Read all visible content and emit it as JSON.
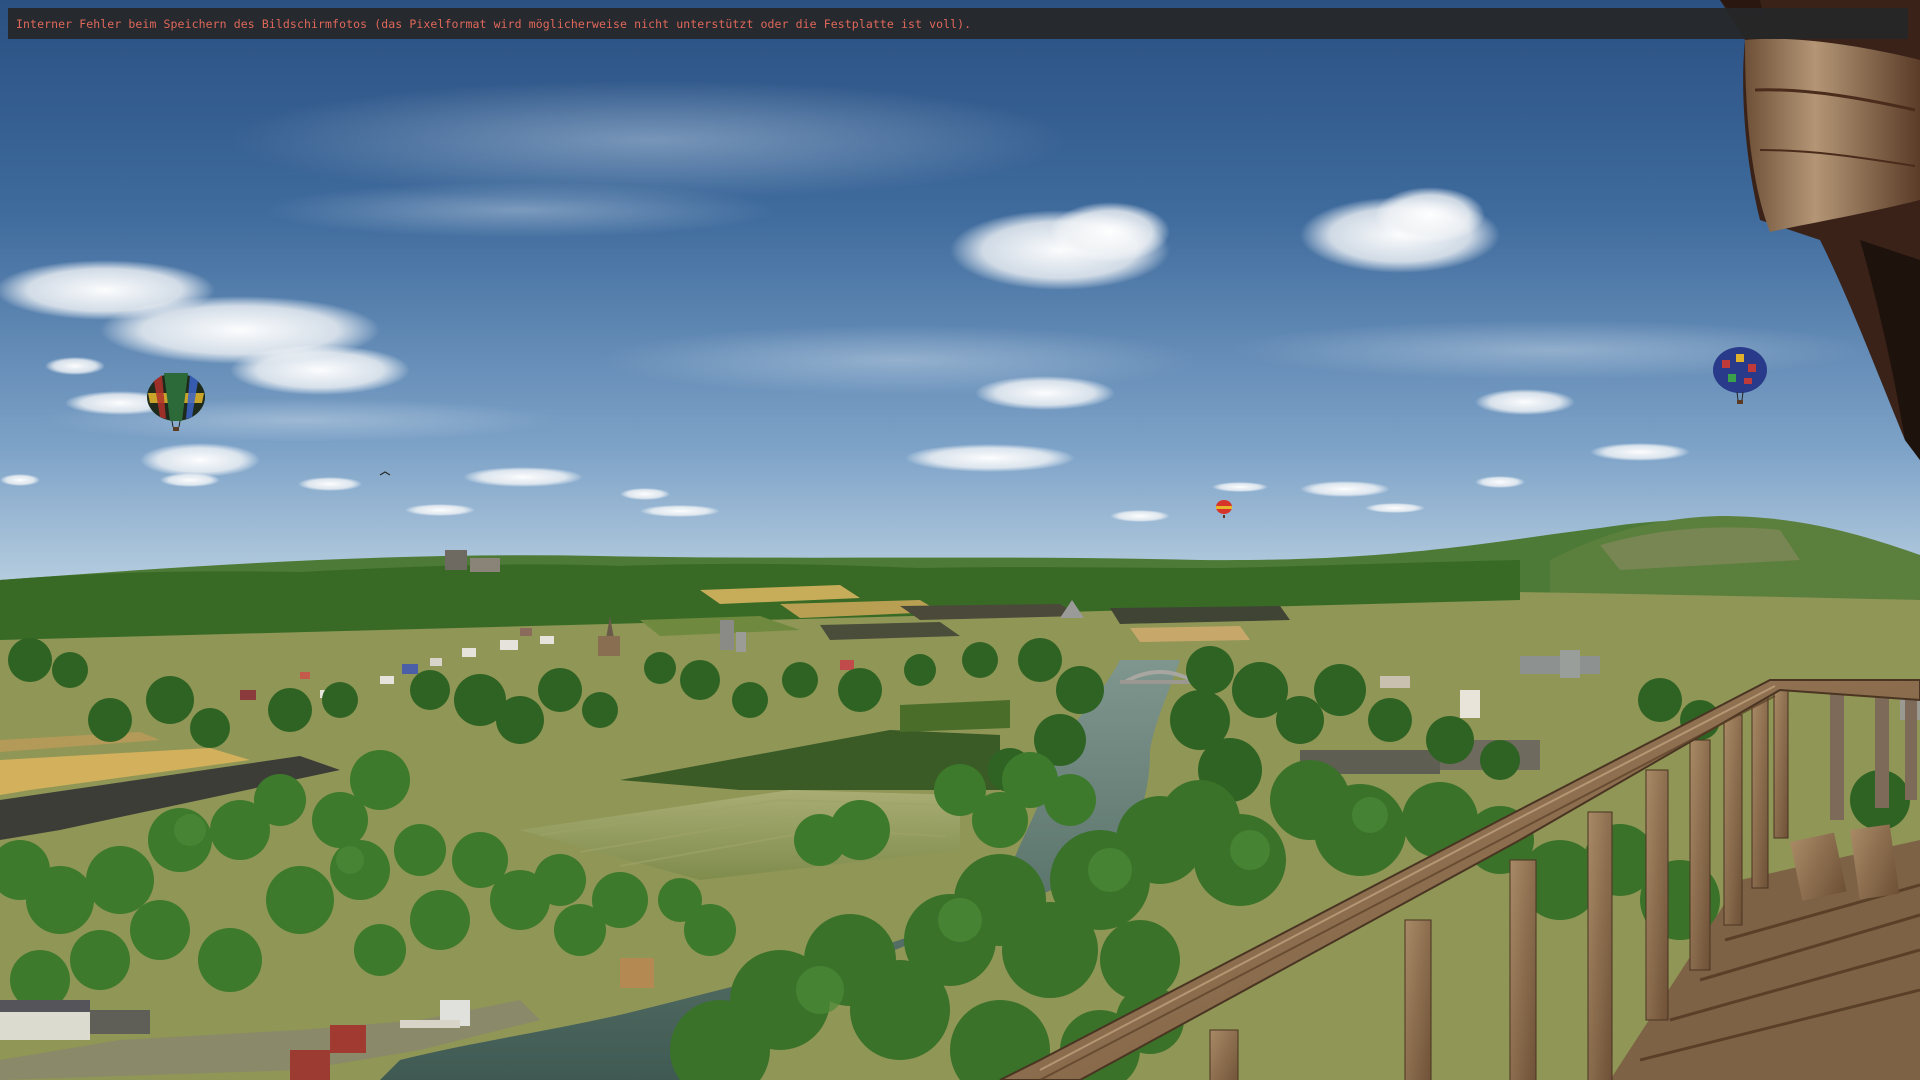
{
  "notification": {
    "error_message": "Interner Fehler beim Speichern des Bildschirmfotos (das Pixelformat wird möglicherweise nicht unterstützt oder die Festplatte ist voll)."
  },
  "colors": {
    "error_text": "#e0685a",
    "error_bar_background": "#262628",
    "sky_top": "#2d5384",
    "sky_horizon": "#b6cde0",
    "forest": "#3a6e2a",
    "river": "#4e6a5e",
    "wood": "#9a7a58"
  },
  "scene": {
    "icons": [
      "hot-air-balloon-icon",
      "bird-icon"
    ]
  }
}
